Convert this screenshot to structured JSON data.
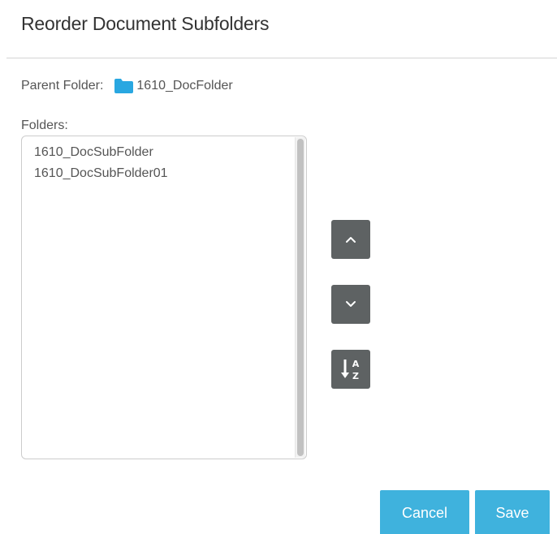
{
  "dialog": {
    "title": "Reorder Document Subfolders"
  },
  "parent": {
    "label": "Parent Folder:",
    "folder_name": "1610_DocFolder",
    "icon": "folder-icon"
  },
  "folders": {
    "label": "Folders:",
    "items": [
      "1610_DocSubFolder",
      "1610_DocSubFolder01"
    ]
  },
  "controls": {
    "move_up_icon": "chevron-up-icon",
    "move_down_icon": "chevron-down-icon",
    "sort_icon": "sort-alpha-down-icon",
    "sort_letter_top": "A",
    "sort_letter_bottom": "Z"
  },
  "footer": {
    "cancel_label": "Cancel",
    "save_label": "Save"
  },
  "colors": {
    "primary_button": "#3fb2dd",
    "icon_button": "#5e6263",
    "folder_icon": "#29a7e1"
  }
}
